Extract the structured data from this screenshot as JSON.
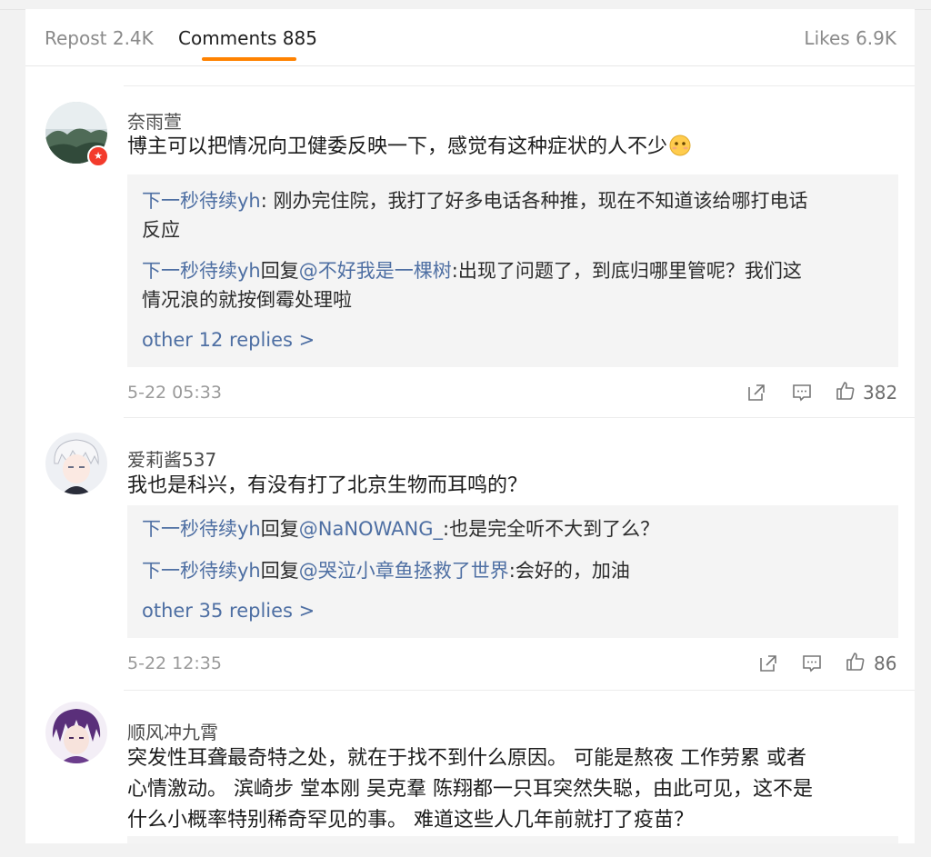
{
  "tabs": {
    "repost": "Repost 2.4K",
    "comments": "Comments 885",
    "likes": "Likes 6.9K"
  },
  "comments": [
    {
      "user": "奈雨萱",
      "text": "博主可以把情况向卫健委反映一下，感觉有这种症状的人不少",
      "emoji": "face-without-mouth",
      "replies": [
        {
          "name": "下一秒待续yh",
          "text": ": 刚办完住院，我打了好多电话各种推，现在不知道该给哪打电话"
        },
        {
          "name": "",
          "text": "反应"
        },
        {
          "name": "下一秒待续yh",
          "mid": "回复",
          "mention": "@不好我是一棵树",
          "text": ":出现了问题了，到底归哪里管呢？我们这"
        },
        {
          "name": "",
          "text": "情况浪的就按倒霉处理啦"
        }
      ],
      "more": "other 12 replies >",
      "time": "5-22 05:33",
      "likes": "382"
    },
    {
      "user": "爱莉酱537",
      "text": "我也是科兴，有没有打了北京生物而耳鸣的？",
      "replies": [
        {
          "name": "下一秒待续yh",
          "mid": "回复",
          "mention": "@NaNOWANG_",
          "text": ":也是完全听不大到了么？"
        },
        {
          "name": "下一秒待续yh",
          "mid": "回复",
          "mention": "@哭泣小章鱼拯救了世界",
          "text": ":会好的，加油"
        }
      ],
      "more": "other 35 replies >",
      "time": "5-22 12:35",
      "likes": "86"
    },
    {
      "user": "顺风冲九霄",
      "lines": [
        "突发性耳聋最奇特之处，就在于找不到什么原因。 可能是熬夜 工作劳累 或者",
        "心情激动。 滨崎步  堂本刚 吴克羣 陈翔都一只耳突然失聪，由此可见，这不是",
        "什么小概率特别稀奇罕见的事。 难道这些人几年前就打了疫苗？"
      ]
    }
  ],
  "icons": [
    "share-icon",
    "comment-icon",
    "like-icon",
    "verified-badge-icon"
  ],
  "colors": {
    "accent": "#ff8200",
    "link": "#4e6fa3",
    "badge": "#f33b2c"
  }
}
